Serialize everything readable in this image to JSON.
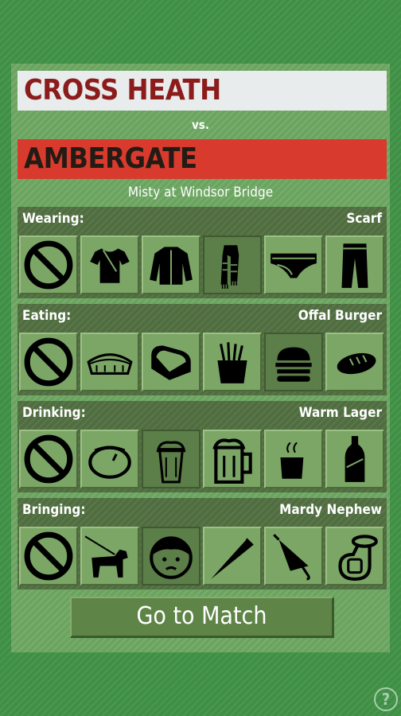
{
  "match": {
    "home_team": "CROSS HEATH",
    "vs_label": "vs.",
    "away_team": "AMBERGATE",
    "venue": "Misty at Windsor Bridge"
  },
  "categories": [
    {
      "label": "Wearing:",
      "value": "Scarf",
      "options": [
        "none-icon",
        "tshirt-icon",
        "jacket-icon",
        "scarf-icon",
        "briefs-icon",
        "trousers-icon"
      ],
      "selected": 3
    },
    {
      "label": "Eating:",
      "value": "Offal Burger",
      "options": [
        "none-icon",
        "pie-icon",
        "sandwich-icon",
        "fries-icon",
        "burger-icon",
        "hotdog-icon"
      ],
      "selected": 4
    },
    {
      "label": "Drinking:",
      "value": "Warm Lager",
      "options": [
        "none-icon",
        "bovril-pot-icon",
        "pint-glass-icon",
        "beer-mug-icon",
        "hot-cup-icon",
        "soda-bottle-icon"
      ],
      "selected": 2
    },
    {
      "label": "Bringing:",
      "value": "Mardy Nephew",
      "options": [
        "none-icon",
        "dog-on-lead-icon",
        "child-face-icon",
        "vuvuzela-icon",
        "umbrella-icon",
        "tuba-icon"
      ],
      "selected": 2
    }
  ],
  "go_button": "Go to Match",
  "help_label": "?",
  "colors": {
    "home_bar": "#e8ecec",
    "home_text": "#8c1c1c",
    "away_bar": "#d83a2e",
    "away_text": "#241b14",
    "panel": "#6aa45f",
    "selected_tile": "#5c7e48"
  }
}
